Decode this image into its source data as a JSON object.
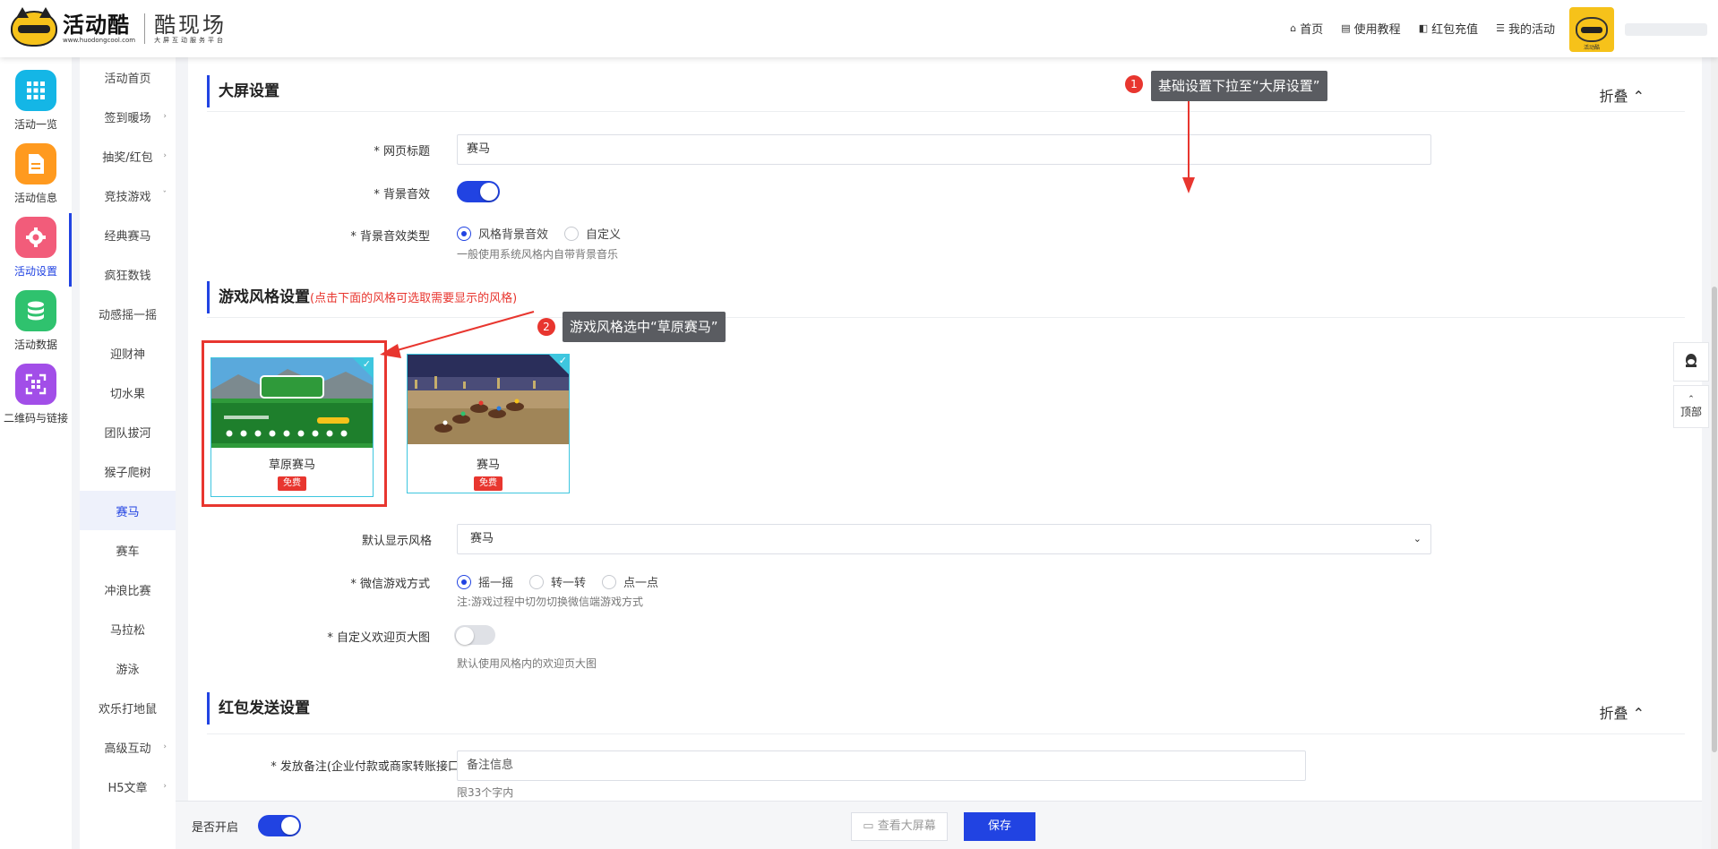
{
  "header": {
    "logo_name": "活动酷",
    "logo_url": "www.huodongcool.com",
    "logo_sub_name": "酷现场",
    "logo_sub_tagline": "大屏互动服务平台",
    "nav": [
      {
        "icon": "home-icon",
        "label": "首页"
      },
      {
        "icon": "book-icon",
        "label": "使用教程"
      },
      {
        "icon": "redpacket-icon",
        "label": "红包充值"
      },
      {
        "icon": "list-icon",
        "label": "我的活动"
      }
    ],
    "avatar_caption": "活动酷"
  },
  "left_nav": [
    {
      "label": "活动一览",
      "icon": "grid-icon",
      "color": "#14b6e6"
    },
    {
      "label": "活动信息",
      "icon": "document-icon",
      "color": "#ff9a1f"
    },
    {
      "label": "活动设置",
      "icon": "gear-icon",
      "color": "#f25c7a",
      "active": true
    },
    {
      "label": "活动数据",
      "icon": "database-icon",
      "color": "#2fc26e"
    },
    {
      "label": "二维码与链接",
      "icon": "qrcode-icon",
      "color": "#a24ee8"
    }
  ],
  "sub_nav": [
    {
      "label": "活动首页"
    },
    {
      "label": "签到暖场",
      "arrow": "›"
    },
    {
      "label": "抽奖/红包",
      "arrow": "›"
    },
    {
      "label": "竞技游戏",
      "arrow": "ˇ"
    },
    {
      "label": "经典赛马"
    },
    {
      "label": "疯狂数钱"
    },
    {
      "label": "动感摇一摇"
    },
    {
      "label": "迎财神"
    },
    {
      "label": "切水果"
    },
    {
      "label": "团队拔河"
    },
    {
      "label": "猴子爬树"
    },
    {
      "label": "赛马",
      "active": true
    },
    {
      "label": "赛车"
    },
    {
      "label": "冲浪比赛"
    },
    {
      "label": "马拉松"
    },
    {
      "label": "游泳"
    },
    {
      "label": "欢乐打地鼠"
    },
    {
      "label": "高级互动",
      "arrow": "›"
    },
    {
      "label": "H5文章",
      "arrow": "›"
    }
  ],
  "screen_settings": {
    "title": "大屏设置",
    "fold": "折叠 ⌃",
    "page_title_label": "* 网页标题",
    "page_title_value": "赛马",
    "bg_sound_label": "* 背景音效",
    "bg_sound_on": true,
    "bg_sound_type_label": "* 背景音效类型",
    "bg_sound_type_options": [
      "风格背景音效",
      "自定义"
    ],
    "bg_sound_type_selected": 0,
    "bg_sound_type_help": "一般使用系统风格内自带背景音乐"
  },
  "style_settings": {
    "title": "游戏风格设置",
    "hint": "(点击下面的风格可选取需要显示的风格)",
    "styles": [
      {
        "name": "草原赛马",
        "tag": "免费",
        "selected": true
      },
      {
        "name": "赛马",
        "tag": "免费",
        "selected": true
      }
    ],
    "default_style_label": "默认显示风格",
    "default_style_value": "赛马",
    "wechat_mode_label": "* 微信游戏方式",
    "wechat_mode_options": [
      "摇一摇",
      "转一转",
      "点一点"
    ],
    "wechat_mode_selected": 0,
    "wechat_mode_help": "注:游戏过程中切勿切换微信端游戏方式",
    "custom_welcome_label": "* 自定义欢迎页大图",
    "custom_welcome_on": false,
    "custom_welcome_help": "默认使用风格内的欢迎页大图"
  },
  "redpacket_settings": {
    "title": "红包发送设置",
    "fold": "折叠 ⌃",
    "remark_label": "* 发放备注(企业付款或商家转账接口)",
    "remark_placeholder": "备注信息",
    "remark_help": "限33个字内"
  },
  "annotations": {
    "tip1_num": "1",
    "tip1_text": "基础设置下拉至“大屏设置”",
    "tip2_num": "2",
    "tip2_text": "游戏风格选中“草原赛马”"
  },
  "bottom_bar": {
    "enable_label": "是否开启",
    "enable_on": true,
    "preview_label": "查看大屏幕",
    "save_label": "保存"
  },
  "side_float": {
    "top_label": "顶部"
  }
}
